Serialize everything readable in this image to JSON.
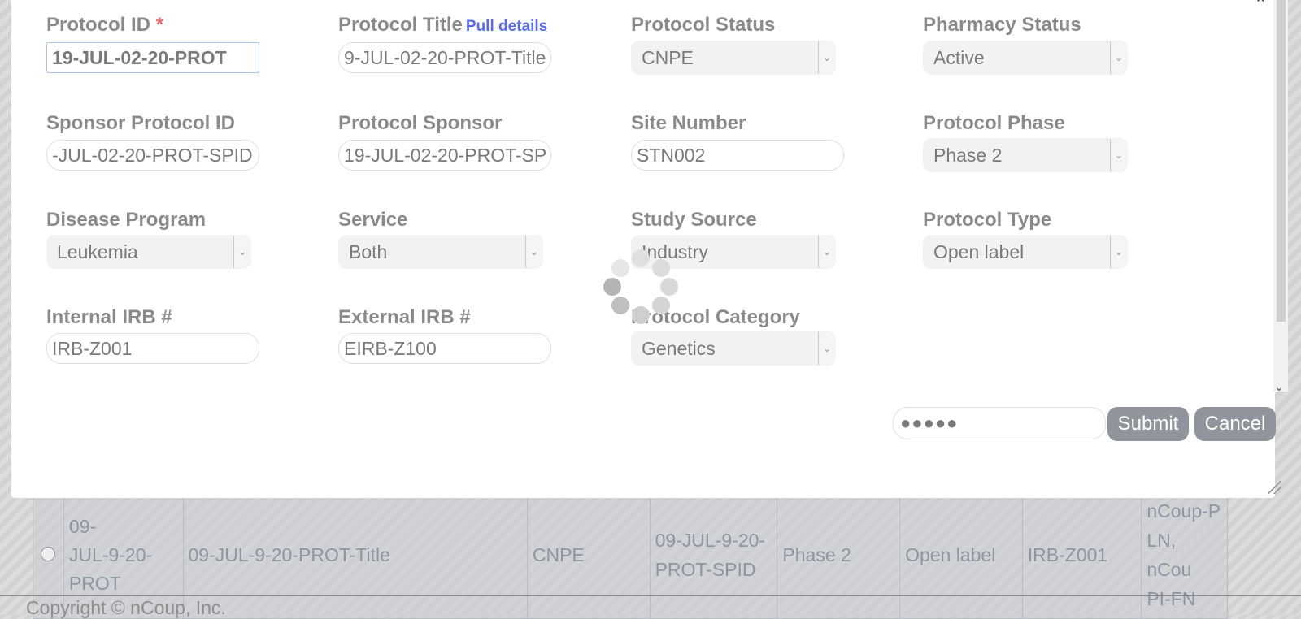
{
  "form": {
    "protocol_id": {
      "label": "Protocol ID",
      "required_mark": "*",
      "value": "19-JUL-02-20-PROT"
    },
    "protocol_title": {
      "label": "Protocol Title",
      "link": "Pull details",
      "value": "9-JUL-02-20-PROT-Title"
    },
    "protocol_status": {
      "label": "Protocol Status",
      "value": "CNPE"
    },
    "pharmacy_status": {
      "label": "Pharmacy Status",
      "value": "Active"
    },
    "sponsor_protocol_id": {
      "label": "Sponsor Protocol ID",
      "value": "-JUL-02-20-PROT-SPID"
    },
    "protocol_sponsor": {
      "label": "Protocol Sponsor",
      "value": "19-JUL-02-20-PROT-SP"
    },
    "site_number": {
      "label": "Site Number",
      "value": "STN002"
    },
    "protocol_phase": {
      "label": "Protocol Phase",
      "value": "Phase 2"
    },
    "disease_program": {
      "label": "Disease Program",
      "value": "Leukemia"
    },
    "service": {
      "label": "Service",
      "value": "Both"
    },
    "study_source": {
      "label": "Study Source",
      "value": "Industry"
    },
    "protocol_type": {
      "label": "Protocol Type",
      "value": "Open label"
    },
    "internal_irb": {
      "label": "Internal IRB #",
      "value": "IRB-Z001"
    },
    "external_irb": {
      "label": "External IRB #",
      "value": "EIRB-Z100"
    },
    "protocol_category": {
      "label": "Protocol Category",
      "value": "Genetics"
    }
  },
  "actions": {
    "password_value": "●●●●●",
    "submit_label": "Submit",
    "cancel_label": "Cancel"
  },
  "background_table": {
    "row": [
      "09-\nJUL-9-20-\nPROT",
      "09-JUL-9-20-PROT-Title",
      "CNPE",
      "09-JUL-9-20-\nPROT-SPID",
      "Phase 2",
      "Open label",
      "IRB-Z001",
      "nCoup-P\nLN, nCou\nPI-FN"
    ]
  },
  "footer": {
    "copyright": "Copyright © nCoup, Inc."
  },
  "icons": {
    "close": "×",
    "dropdown": "chevron-down-icon",
    "scroll_down": "chevron-down-icon"
  },
  "colors": {
    "label": "#8a8a8a",
    "required": "#e46b6b",
    "link": "#5c6ce4",
    "button": "#8f959b"
  }
}
